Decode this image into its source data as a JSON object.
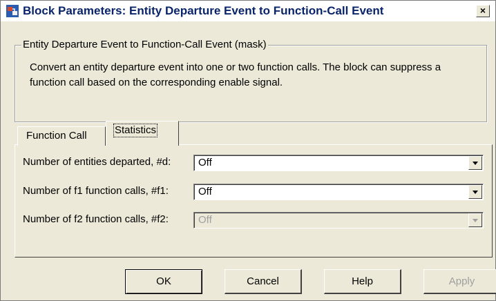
{
  "window": {
    "title": "Block Parameters: Entity Departure Event to Function-Call Event",
    "close_glyph": "×"
  },
  "group": {
    "legend": "Entity Departure Event to Function-Call Event (mask)",
    "description": "Convert an entity departure event into one or two function calls. The block can suppress a function call based on the corresponding enable signal."
  },
  "tabs": [
    {
      "label": "Function Call",
      "selected": false
    },
    {
      "label": "Statistics",
      "selected": true
    }
  ],
  "params": [
    {
      "label": "Number of entities departed, #d:",
      "value": "Off",
      "enabled": true
    },
    {
      "label": "Number of f1 function calls, #f1:",
      "value": "Off",
      "enabled": true
    },
    {
      "label": "Number of f2 function calls, #f2:",
      "value": "Off",
      "enabled": false
    }
  ],
  "buttons": {
    "ok": "OK",
    "cancel": "Cancel",
    "help": "Help",
    "apply": "Apply"
  },
  "colors": {
    "title_text": "#0a246a",
    "dialog_bg": "#ece9d8"
  },
  "icons": {
    "app": "simulink-block-icon",
    "dropdown": "chevron-down-icon"
  }
}
